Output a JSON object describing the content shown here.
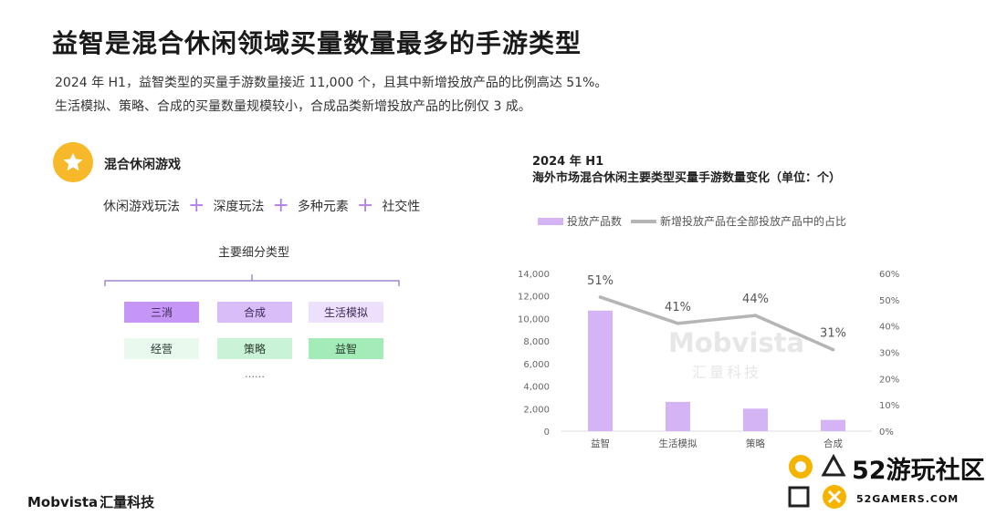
{
  "title": "益智是混合休闲领域买量数量最多的手游类型",
  "description": [
    "2024 年 H1，益智类型的买量手游数量接近 11,000 个，且其中新增投放产品的比例高达 51%。",
    "生活模拟、策略、合成的买量数量规模较小，合成品类新增投放产品的比例仅 3 成。"
  ],
  "left_panel": {
    "icon": "star-icon",
    "section_title": "混合休闲游戏",
    "formula": [
      "休闲游戏玩法",
      "深度玩法",
      "多种元素",
      "社交性"
    ],
    "subtype_title": "主要细分类型",
    "subtypes": [
      {
        "label": "三消",
        "bg": "#c596f5",
        "fg": "#3a2a55"
      },
      {
        "label": "合成",
        "bg": "#d9bdf8",
        "fg": "#3a2a55"
      },
      {
        "label": "生活模拟",
        "bg": "#ece0fc",
        "fg": "#3a2a55"
      },
      {
        "label": "经营",
        "bg": "#e9f9ee",
        "fg": "#2a3a30"
      },
      {
        "label": "策略",
        "bg": "#c9f2d6",
        "fg": "#2a3a30"
      },
      {
        "label": "益智",
        "bg": "#a3ebb7",
        "fg": "#2a3a30"
      }
    ],
    "ellipsis": "……"
  },
  "chart_titles": [
    "2024 年 H1",
    "海外市场混合休闲主要类型买量手游数量变化（单位：个）"
  ],
  "watermark": {
    "main": "Mobvista",
    "sub": "汇量科技"
  },
  "chart_data": {
    "type": "bar",
    "categories": [
      "益智",
      "生活模拟",
      "策略",
      "合成"
    ],
    "series": [
      {
        "name": "投放产品数",
        "type": "bar",
        "axis": "left",
        "color": "#d4b4f5",
        "values": [
          10700,
          2600,
          2000,
          1000
        ]
      },
      {
        "name": "新增投放产品在全部投放产品中的占比",
        "type": "line",
        "axis": "right",
        "color": "#b5b5b5",
        "values": [
          51,
          41,
          44,
          31
        ],
        "labels": [
          "51%",
          "41%",
          "44%",
          "31%"
        ]
      }
    ],
    "y_left": {
      "min": 0,
      "max": 14000,
      "ticks": [
        0,
        2000,
        4000,
        6000,
        8000,
        10000,
        12000,
        14000
      ],
      "tick_labels": [
        "0",
        "2,000",
        "4,000",
        "6,000",
        "8,000",
        "10,000",
        "12,000",
        "14,000"
      ]
    },
    "y_right": {
      "min": 0,
      "max": 60,
      "ticks": [
        0,
        10,
        20,
        30,
        40,
        50,
        60
      ],
      "tick_labels": [
        "0%",
        "10%",
        "20%",
        "30%",
        "40%",
        "50%",
        "60%"
      ]
    },
    "legend": "top",
    "grid": false
  },
  "footer_logo": {
    "brand": "Mobvista",
    "cn": "汇量科技"
  },
  "site_logo": {
    "big": "52游玩社区",
    "small": "52GAMERS.COM"
  }
}
